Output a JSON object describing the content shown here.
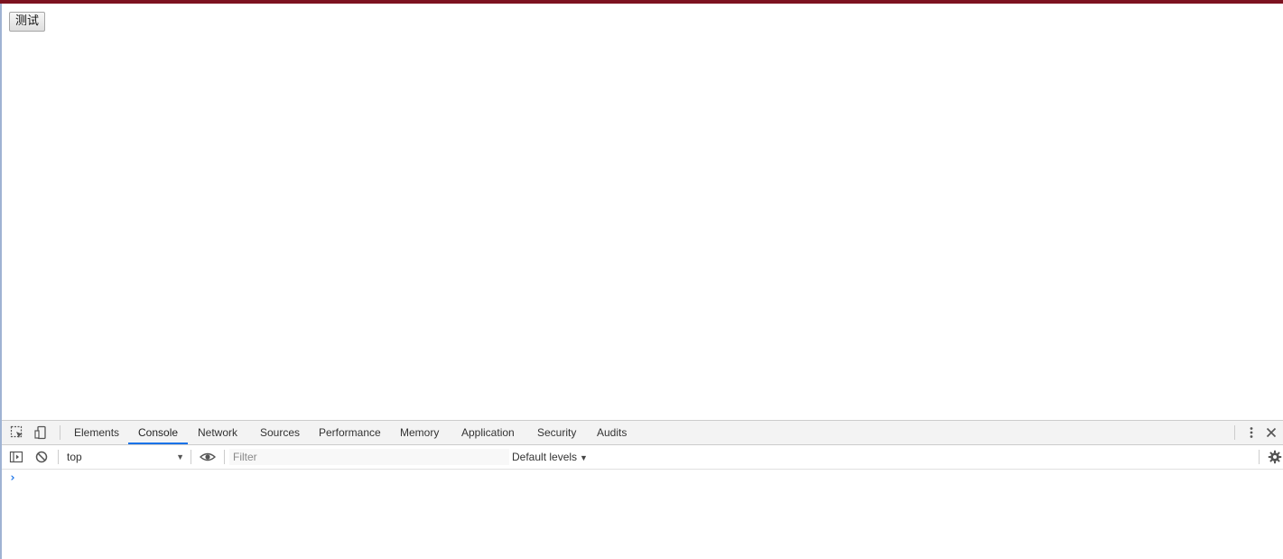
{
  "page": {
    "button_label": "测试"
  },
  "devtools": {
    "tabs": [
      {
        "label": "Elements"
      },
      {
        "label": "Console",
        "active": true
      },
      {
        "label": "Network"
      },
      {
        "label": "Sources"
      },
      {
        "label": "Performance"
      },
      {
        "label": "Memory"
      },
      {
        "label": "Application"
      },
      {
        "label": "Security"
      },
      {
        "label": "Audits"
      }
    ],
    "icons": {
      "inspect": "inspect-element-icon",
      "device": "device-toolbar-icon",
      "more": "more-vert-icon",
      "close": "close-icon",
      "sidebar": "sidebar-toggle-icon",
      "clear": "clear-console-icon",
      "eye": "live-expression-eye-icon",
      "settings": "gear-icon"
    },
    "console": {
      "context_value": "top",
      "filter_placeholder": "Filter",
      "levels_label": "Default levels",
      "prompt_symbol": "›"
    }
  },
  "colors": {
    "top_strip": "#7d1220",
    "active_tab_underline": "#1a73e8",
    "prompt": "#1a73e8"
  }
}
